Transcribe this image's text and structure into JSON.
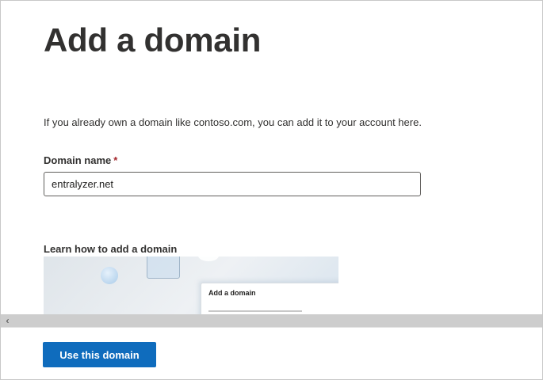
{
  "page": {
    "title": "Add a domain",
    "intro": "If you already own a domain like contoso.com, you can add it to your account here."
  },
  "domain_field": {
    "label": "Domain name",
    "required_marker": "*",
    "value": "entralyzer.net"
  },
  "learn": {
    "heading": "Learn how to add a domain",
    "thumbnail_title": "Add a domain"
  },
  "scrollbar": {
    "left_arrow": "‹"
  },
  "footer": {
    "primary_button": "Use this domain"
  },
  "colors": {
    "accent": "#0f6cbd",
    "required": "#a4262c"
  }
}
